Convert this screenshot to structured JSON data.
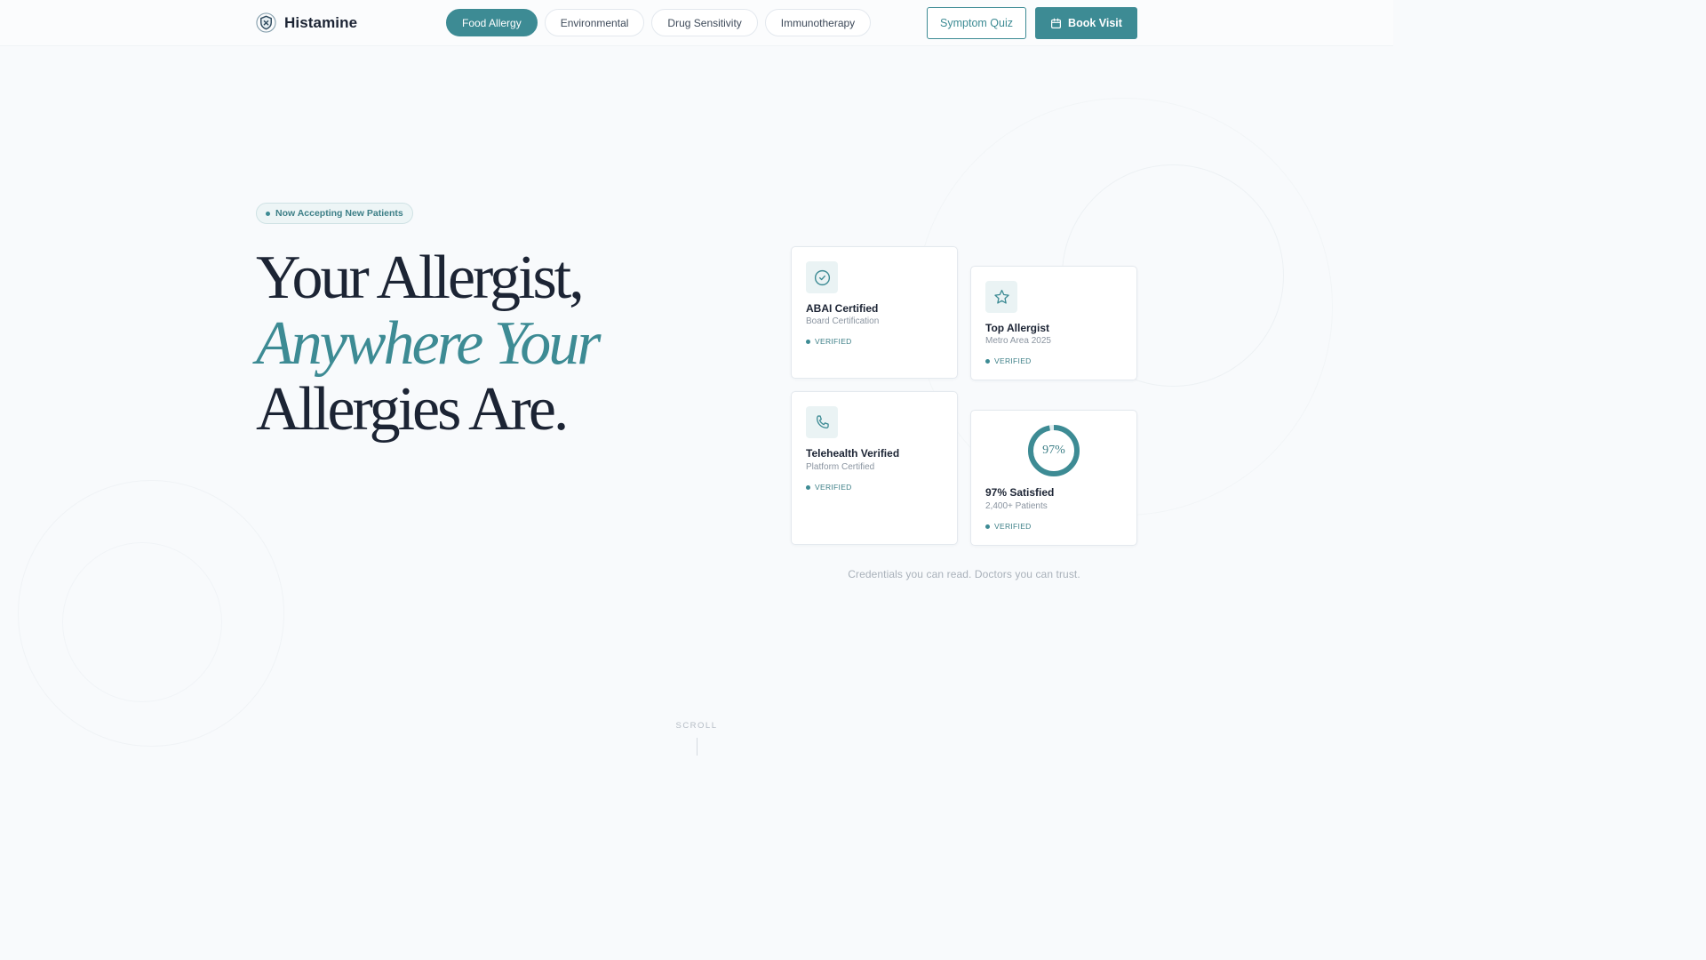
{
  "brand": {
    "name": "Histamine",
    "logo_icon": "shield-icon"
  },
  "nav": {
    "tabs": [
      {
        "label": "Food Allergy",
        "active": true
      },
      {
        "label": "Environmental",
        "active": false
      },
      {
        "label": "Drug Sensitivity",
        "active": false
      },
      {
        "label": "Immunotherapy",
        "active": false
      }
    ],
    "symptom_quiz_label": "Symptom Quiz",
    "book_visit_label": "Book Visit",
    "book_visit_icon": "calendar-icon"
  },
  "hero": {
    "badge": "Now Accepting New Patients",
    "headline_line1": "Your Allergist,",
    "headline_line2": "Anywhere Your",
    "headline_line3": "Allergies Are."
  },
  "credentials": [
    {
      "icon": "check-circle-icon",
      "title": "ABAI Certified",
      "subtitle": "Board Certification",
      "status": "VERIFIED"
    },
    {
      "icon": "star-icon",
      "title": "Top Allergist",
      "subtitle": "Metro Area 2025",
      "status": "VERIFIED"
    },
    {
      "icon": "phone-icon",
      "title": "Telehealth Verified",
      "subtitle": "Platform Certified",
      "status": "VERIFIED"
    },
    {
      "icon": "donut-progress",
      "percent_label": "97%",
      "percent_value": 0.97,
      "title": "97% Satisfied",
      "subtitle": "2,400+ Patients",
      "status": "VERIFIED"
    }
  ],
  "tagline": "Credentials you can read. Doctors you can trust.",
  "scroll_label": "SCROLL",
  "colors": {
    "accent": "#3d8b94",
    "ink": "#1c2434",
    "muted": "#8a94a0",
    "background": "#f8fafc"
  }
}
